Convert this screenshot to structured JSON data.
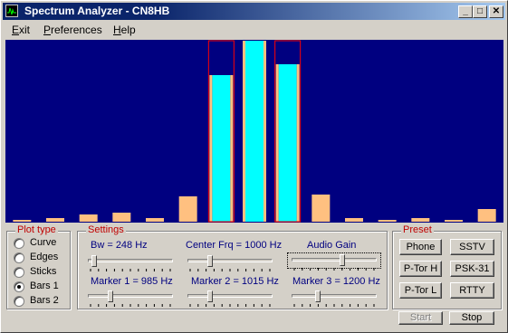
{
  "window": {
    "title": "Spectrum Analyzer - CN8HB",
    "controls": {
      "minimize": "_",
      "maximize": "□",
      "close": "✕"
    }
  },
  "menu": [
    {
      "label": "Exit",
      "mnemonic": "E",
      "rest": "xit"
    },
    {
      "label": "Preferences",
      "mnemonic": "P",
      "rest": "references"
    },
    {
      "label": "Help",
      "mnemonic": "H",
      "rest": "elp"
    }
  ],
  "colors": {
    "plot_bg": "#000080",
    "bar_main": "#00ffff",
    "bar_side": "#ffc080",
    "marker_box": "#ff0000",
    "label_red": "#c00000",
    "label_blue": "#000080"
  },
  "chart_data": {
    "type": "bar",
    "ylim": [
      0,
      100
    ],
    "values": [
      1,
      2,
      4,
      5,
      2,
      14,
      0,
      0,
      0,
      15,
      2,
      1,
      2,
      1,
      7
    ],
    "highlight": [
      {
        "index": 6,
        "value": 81,
        "peak": 100,
        "marker": true
      },
      {
        "index": 7,
        "value": 100,
        "peak": 100,
        "marker": false
      },
      {
        "index": 8,
        "value": 87,
        "peak": 100,
        "marker": true
      }
    ]
  },
  "plot_type": {
    "legend": "Plot type",
    "options": [
      "Curve",
      "Edges",
      "Sticks",
      "Bars 1",
      "Bars 2"
    ],
    "selected": "Bars 1"
  },
  "settings": {
    "legend": "Settings",
    "bw": {
      "label": "Bw = 248 Hz",
      "level": 0.05
    },
    "center": {
      "label": "Center Frq = 1000 Hz",
      "level": 0.25
    },
    "gain": {
      "label": "Audio Gain",
      "level": 0.6
    },
    "marker1": {
      "label": "Marker 1 = 985 Hz",
      "level": 0.25
    },
    "marker2": {
      "label": "Marker 2 = 1015 Hz",
      "level": 0.25
    },
    "marker3": {
      "label": "Marker 3 = 1200 Hz",
      "level": 0.3
    }
  },
  "preset": {
    "legend": "Preset",
    "buttons": [
      "Phone",
      "SSTV",
      "P-Tor H",
      "PSK-31",
      "P-Tor L",
      "RTTY"
    ]
  },
  "actions": {
    "start": "Start",
    "stop": "Stop"
  }
}
